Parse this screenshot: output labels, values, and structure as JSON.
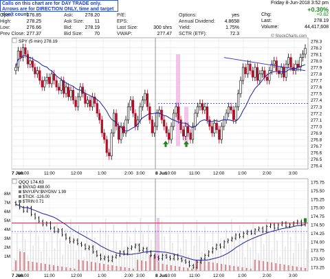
{
  "notice": {
    "line1": "Calls on this chart are for DAY TRADE only.",
    "line2": "Arrows are for DIRECTION ONLY, time and target don't count."
  },
  "quote": {
    "col1": [
      [
        "Open:",
        "276.85"
      ],
      [
        "High:",
        "278.25"
      ],
      [
        "Low:",
        "276.66"
      ],
      [
        "Prev Close:",
        "277.37"
      ]
    ],
    "col2": [
      [
        "Ask:",
        "278.20"
      ],
      [
        "Ask Size:",
        "11"
      ],
      [
        "Bid:",
        "278.19"
      ],
      [
        "Bid Size:",
        "70"
      ]
    ],
    "col3": [
      [
        "P/E:",
        ""
      ],
      [
        "EPS:",
        ""
      ],
      [
        "Last Size:",
        "300 shrs"
      ],
      [
        "VWAP:",
        "277.47"
      ]
    ],
    "col4": [
      [
        "Options:",
        "yes"
      ],
      [
        "Annual Dividend:",
        "4.8658"
      ],
      [
        "Yield:",
        "1.75%"
      ],
      [
        "SCTR (ETF):",
        "72.3"
      ]
    ],
    "date": "Friday  8-Jun-2018  3:52 pm",
    "pct": "+0.30%",
    "chg_label": "Chg:",
    "chg": "+0.82",
    "last_label": "Last:",
    "last": "278.19",
    "vol_label": "Volume:",
    "volume": "44,417,608",
    "watermark": "© StockCharts.com"
  },
  "colors": {
    "up": "#000000",
    "down": "#b0102a",
    "ma": "#1a1f9a",
    "ref": "#2a2ad8",
    "highlight": "#f2b8e6",
    "arrow": "#1a8a1a",
    "vwap_line": "#c0203a"
  },
  "chart_data": [
    {
      "type": "candlestick",
      "title": "SPY (5 min) 278.19",
      "ylim": [
        276.35,
        278.35
      ],
      "yticks": [
        "278.3",
        "278.2",
        "278.1",
        "278.0",
        "277.9",
        "277.8",
        "277.7",
        "277.6",
        "277.5",
        "277.4",
        "277.3",
        "277.2",
        "277.1",
        "277.0",
        "276.9",
        "276.8",
        "276.7",
        "276.6",
        "276.5",
        "276.4"
      ],
      "xticks": [
        "7 Jun",
        "10:00",
        "11:00",
        "12:00",
        "1:00",
        "2:00",
        "3:00",
        "8 Jun",
        "10:00",
        "11:00",
        "12:00",
        "1:00",
        "2:00",
        "3:00"
      ],
      "ref_level": 277.35,
      "arrows_at": [
        276.72,
        276.72
      ],
      "close": [
        277.9,
        278.15,
        278.05,
        278.2,
        278.1,
        277.95,
        278.0,
        277.9,
        277.8,
        277.85,
        277.7,
        277.6,
        277.7,
        277.75,
        277.65,
        277.8,
        277.7,
        277.6,
        277.55,
        277.7,
        277.5,
        277.6,
        277.45,
        277.55,
        277.4,
        277.3,
        277.45,
        277.6,
        277.5,
        277.35,
        277.4,
        277.3,
        277.45,
        277.35,
        277.2,
        277.1,
        276.9,
        276.8,
        276.6,
        276.55,
        276.9,
        277.2,
        277.0,
        276.8,
        277.0,
        276.9,
        277.1,
        277.3,
        277.4,
        277.2,
        277.0,
        277.1,
        277.3,
        277.4,
        277.5,
        277.3,
        277.1,
        276.9,
        277.0,
        277.2,
        277.25,
        277.1,
        277.0,
        276.9,
        276.8,
        277.0,
        277.2,
        277.3,
        277.1,
        276.95,
        276.85,
        277.0,
        276.9,
        276.8,
        277.0,
        277.2,
        277.3,
        277.35,
        277.25,
        277.3,
        277.1,
        277.0,
        276.9,
        277.05,
        276.95,
        276.8,
        277.0,
        277.1,
        277.2,
        277.3,
        277.25,
        277.1,
        277.3,
        277.5,
        277.7,
        277.9,
        277.8,
        277.95,
        277.85,
        277.75,
        277.9,
        277.7,
        277.8,
        277.85,
        277.75,
        277.7,
        277.85,
        277.95,
        278.0,
        277.85,
        277.8,
        277.9,
        277.75,
        277.95,
        278.05,
        277.9,
        277.85,
        277.95,
        277.9,
        278.05,
        278.1,
        278.19
      ]
    },
    {
      "type": "line",
      "title": "QQQ 174.63",
      "legend": [
        "$NYAD 488.00",
        "$NYUPV:$NYDNV 1.99",
        "$TICK -126.00",
        "$TRIN 0.71"
      ],
      "ylim": [
        173.15,
        175.85
      ],
      "yticks": [
        "175.75",
        "175.50",
        "175.25",
        "175.00",
        "174.75",
        "174.50",
        "174.25",
        "174.00",
        "173.75",
        "173.50",
        "173.25"
      ],
      "vol_labels": [
        "8M",
        "7M",
        "6M",
        "5M",
        "4M",
        "3M",
        "2M",
        "1M"
      ],
      "xticks": [
        "7 Jun",
        "10:00",
        "11:00",
        "12:00",
        "1:00",
        "2:00",
        "3:00",
        "8 Jun",
        "10:00",
        "11:00",
        "12:00",
        "1:00",
        "2:00",
        "3:00"
      ],
      "ref_level": 174.55,
      "ref_level2": 174.3,
      "values": [
        175.1,
        175.0,
        174.9,
        175.0,
        174.8,
        174.7,
        174.6,
        174.5,
        174.55,
        174.4,
        174.3,
        174.35,
        174.2,
        174.1,
        174.0,
        174.05,
        173.95,
        173.9,
        173.8,
        173.85,
        173.7,
        173.6,
        173.5,
        173.55,
        173.45,
        173.55,
        173.6,
        173.7,
        173.65,
        173.8,
        173.85,
        173.9,
        173.75,
        173.8,
        173.7,
        173.6,
        173.55,
        173.5,
        173.6,
        173.55,
        173.5,
        173.6,
        173.5,
        173.45,
        173.4,
        173.3,
        173.25,
        173.4,
        173.5,
        173.6,
        173.7,
        173.8,
        173.9,
        173.85,
        174.0,
        174.05,
        174.1,
        174.2,
        174.15,
        174.25,
        174.3,
        174.25,
        174.35,
        174.4,
        174.3,
        174.45,
        174.5,
        174.4,
        174.5,
        174.55,
        174.45,
        174.5,
        174.55,
        174.6,
        174.5,
        174.63
      ]
    }
  ]
}
